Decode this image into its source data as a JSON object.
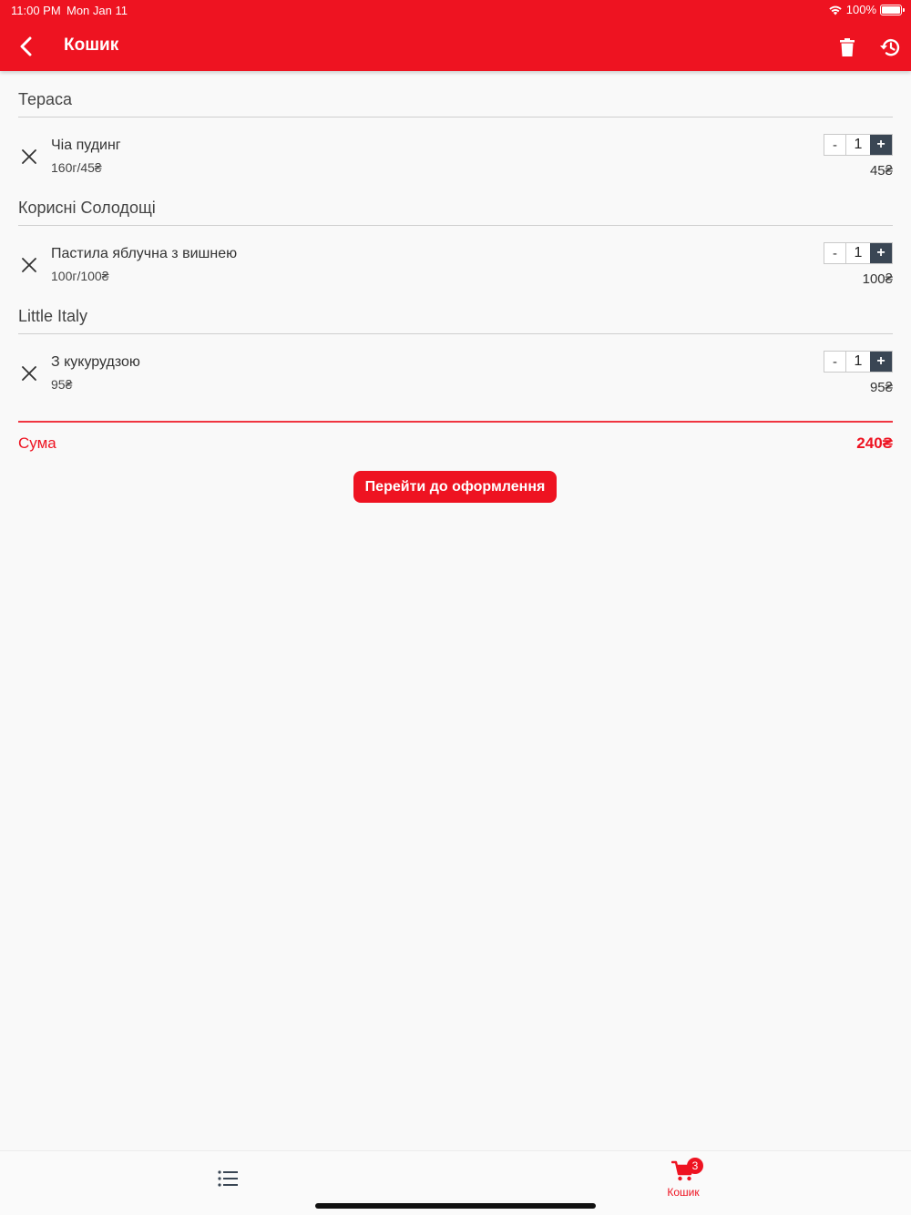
{
  "status_bar": {
    "time": "11:00 PM",
    "date": "Mon Jan 11",
    "battery": "100%"
  },
  "header": {
    "title": "Кошик",
    "background_color": "#ee1321",
    "icons": [
      "chevron-left-icon",
      "trash-icon",
      "history-icon"
    ]
  },
  "groups": [
    {
      "title": "Тераса",
      "items": [
        {
          "name": "Чіа пудинг",
          "meta": "160г/45₴",
          "qty": "1",
          "price": "45₴",
          "minus": "-",
          "plus": "+"
        }
      ]
    },
    {
      "title": "Корисні Солодощі",
      "items": [
        {
          "name": "Пастила яблучна з вишнею",
          "meta": "100г/100₴",
          "qty": "1",
          "price": "100₴",
          "minus": "-",
          "plus": "+"
        }
      ]
    },
    {
      "title": "Little Italy",
      "items": [
        {
          "name": "З кукурудзою",
          "meta": "95₴",
          "qty": "1",
          "price": "95₴",
          "minus": "-",
          "plus": "+"
        }
      ]
    }
  ],
  "summary": {
    "label": "Сума",
    "total": "240₴"
  },
  "checkout": {
    "label": "Перейти до оформлення"
  },
  "tabbar": {
    "cart_label": "Кошик",
    "cart_badge": "3",
    "accent_color": "#ee1321"
  }
}
